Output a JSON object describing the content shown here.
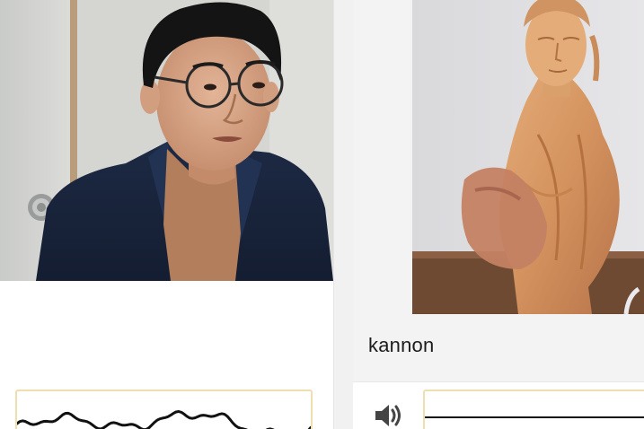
{
  "left_panel": {
    "webcam": {
      "subject": "person-webcam-feed"
    },
    "waveform": {
      "stroke_color": "#111111",
      "border_color": "#eedfb0"
    }
  },
  "right_panel": {
    "preview": {
      "subject": "wooden-statue-image"
    },
    "class_label": "kannon",
    "speaker_icon": "speaker-icon",
    "level_meter": {
      "line_color": "#111111",
      "border_color": "#eedfb0"
    }
  }
}
